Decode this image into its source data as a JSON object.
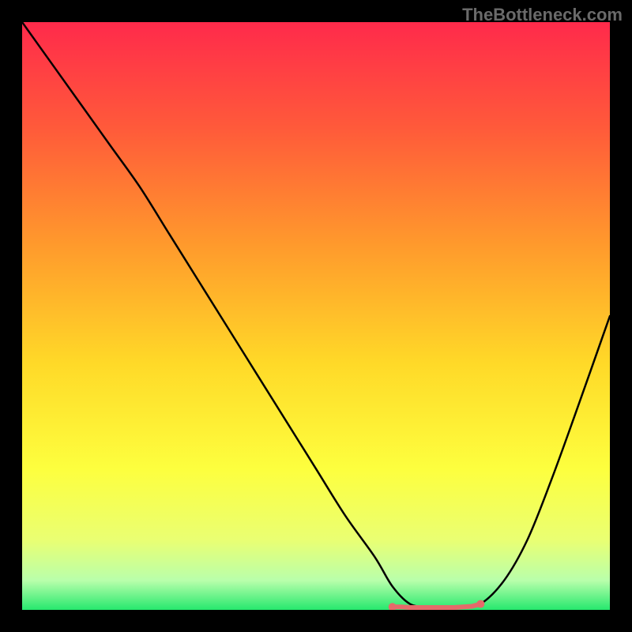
{
  "watermark": "TheBottleneck.com",
  "colors": {
    "background": "#000000",
    "gradient_top": "#ff2a4b",
    "gradient_mid1": "#ff6a33",
    "gradient_mid2": "#ffb028",
    "gradient_mid3": "#ffe629",
    "gradient_mid4": "#f7ff52",
    "gradient_mid5": "#d6ff8e",
    "gradient_bottom": "#26e86e",
    "line": "#000000",
    "marker": "#e66a6a"
  },
  "chart_data": {
    "type": "line",
    "title": "",
    "xlabel": "",
    "ylabel": "",
    "xlim": [
      0,
      100
    ],
    "ylim": [
      0,
      100
    ],
    "series": [
      {
        "name": "bottleneck-curve",
        "x": [
          0,
          5,
          10,
          15,
          20,
          25,
          30,
          35,
          40,
          45,
          50,
          55,
          60,
          63,
          66,
          69,
          72,
          75,
          78,
          82,
          86,
          90,
          94,
          100
        ],
        "y": [
          100,
          93,
          86,
          79,
          72,
          64,
          56,
          48,
          40,
          32,
          24,
          16,
          9,
          4,
          1,
          0.5,
          0.4,
          0.5,
          1,
          5,
          12,
          22,
          33,
          50
        ]
      }
    ],
    "bottom_band": {
      "x_start": 63,
      "x_end": 78,
      "y": 0.5,
      "marker_x": [
        63,
        64.5,
        66,
        67.5,
        69,
        70.5,
        72,
        73.5,
        75,
        76.5,
        78
      ],
      "marker_y": [
        0.5,
        0.5,
        0.4,
        0.4,
        0.4,
        0.4,
        0.4,
        0.4,
        0.5,
        0.6,
        1.0
      ],
      "marker_color": "#e66a6a"
    }
  }
}
